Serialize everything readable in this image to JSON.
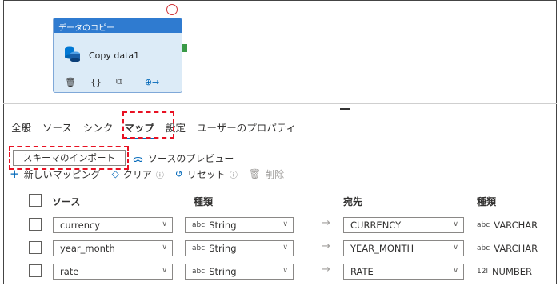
{
  "activity": {
    "header": "データのコピー",
    "name": "Copy data1",
    "tools": [
      "delete-icon",
      "code-icon",
      "copy-icon",
      "add-output-icon"
    ]
  },
  "tabs": [
    {
      "label": "全般"
    },
    {
      "label": "ソース"
    },
    {
      "label": "シンク"
    },
    {
      "label": "マップ",
      "active": true
    },
    {
      "label": "設定"
    },
    {
      "label": "ユーザーのプロパティ"
    }
  ],
  "toolbar": {
    "import_schema": "スキーマのインポート",
    "preview_source": "ソースのプレビュー",
    "new_mapping": "新しいマッピング",
    "clear": "クリア",
    "reset": "リセット",
    "delete": "削除"
  },
  "table": {
    "headers": {
      "source": "ソース",
      "type": "種類",
      "destination": "宛先",
      "dest_type": "種類"
    },
    "rows": [
      {
        "source": "currency",
        "type": "String",
        "type_badge": "abc",
        "destination": "CURRENCY",
        "dest_type": "VARCHAR",
        "dest_badge": "abc"
      },
      {
        "source": "year_month",
        "type": "String",
        "type_badge": "abc",
        "destination": "YEAR_MONTH",
        "dest_type": "VARCHAR",
        "dest_badge": "abc"
      },
      {
        "source": "rate",
        "type": "String",
        "type_badge": "abc",
        "destination": "RATE",
        "dest_type": "NUMBER",
        "dest_badge": "12l"
      }
    ]
  },
  "colors": {
    "accent": "#0067b8",
    "activity_header": "#2f7bd0",
    "activity_body": "#dcebf7",
    "highlight_dash": "#e81123",
    "success_connector": "#3a9a47"
  }
}
